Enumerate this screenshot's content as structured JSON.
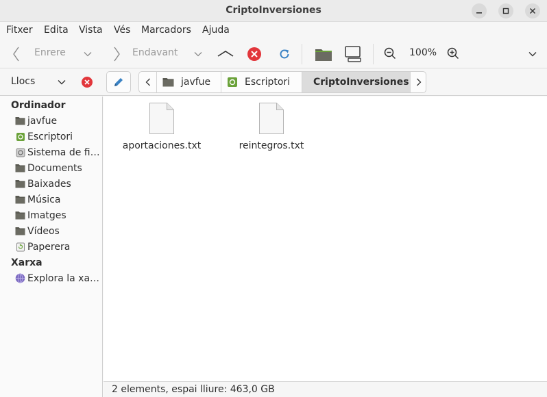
{
  "window": {
    "title": "CriptoInversiones"
  },
  "menubar": {
    "items": [
      "Fitxer",
      "Edita",
      "Vista",
      "Vés",
      "Marcadors",
      "Ajuda"
    ]
  },
  "toolbar": {
    "back_label": "Enrere",
    "forward_label": "Endavant",
    "zoom_level": "100%"
  },
  "locationbar": {
    "places_label": "Llocs",
    "breadcrumbs": [
      "javfue",
      "Escriptori",
      "CriptoInversiones"
    ]
  },
  "sidebar": {
    "sections": [
      {
        "title": "Ordinador",
        "items": [
          {
            "label": "javfue",
            "icon": "folder-icon"
          },
          {
            "label": "Escriptori",
            "icon": "desktop-icon"
          },
          {
            "label": "Sistema de fi…",
            "icon": "drive-icon"
          },
          {
            "label": "Documents",
            "icon": "folder-icon"
          },
          {
            "label": "Baixades",
            "icon": "folder-icon"
          },
          {
            "label": "Música",
            "icon": "folder-icon"
          },
          {
            "label": "Imatges",
            "icon": "folder-icon"
          },
          {
            "label": "Vídeos",
            "icon": "folder-icon"
          },
          {
            "label": "Paperera",
            "icon": "trash-icon"
          }
        ]
      },
      {
        "title": "Xarxa",
        "items": [
          {
            "label": "Explora la xa…",
            "icon": "network-icon"
          }
        ]
      }
    ]
  },
  "files": [
    {
      "name": "aportaciones.txt",
      "icon": "text-file-icon"
    },
    {
      "name": "reintegros.txt",
      "icon": "text-file-icon"
    }
  ],
  "status": {
    "text": "2 elements, espai lliure: 463,0 GB"
  },
  "colors": {
    "folder": "#5a5a52",
    "close_red": "#e2363b",
    "reload_blue": "#3a82c4",
    "accent_green": "#6ba23a"
  }
}
